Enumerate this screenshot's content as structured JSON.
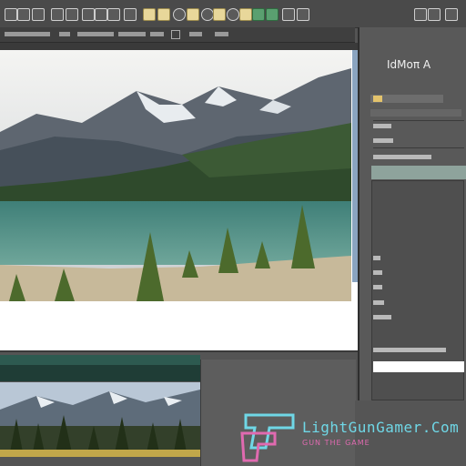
{
  "toolbar": {
    "icons": [
      "square-icon",
      "square-icon",
      "square-icon",
      "square-icon",
      "square-icon",
      "square-icon",
      "square-icon",
      "square-icon",
      "square-icon",
      "square-icon",
      "photo-icon",
      "photo-icon",
      "circle-icon",
      "photo-icon",
      "photo-icon",
      "circle-icon",
      "photo-icon",
      "circle-icon",
      "grid-icon",
      "grid-icon"
    ]
  },
  "optionbar": {
    "items": [
      "",
      "",
      "",
      "",
      ""
    ]
  },
  "canvas": {
    "description_free": true
  },
  "right_panel": {
    "header": "IdMoπ A"
  },
  "watermark": {
    "title": "LightGunGamer.Com",
    "subtitle": "GUN THE GAME"
  },
  "colors": {
    "accent_teal": "#6fd7e6",
    "accent_pink": "#e06ab0",
    "panel": "#595959",
    "canvas_bg": "#ffffff"
  }
}
